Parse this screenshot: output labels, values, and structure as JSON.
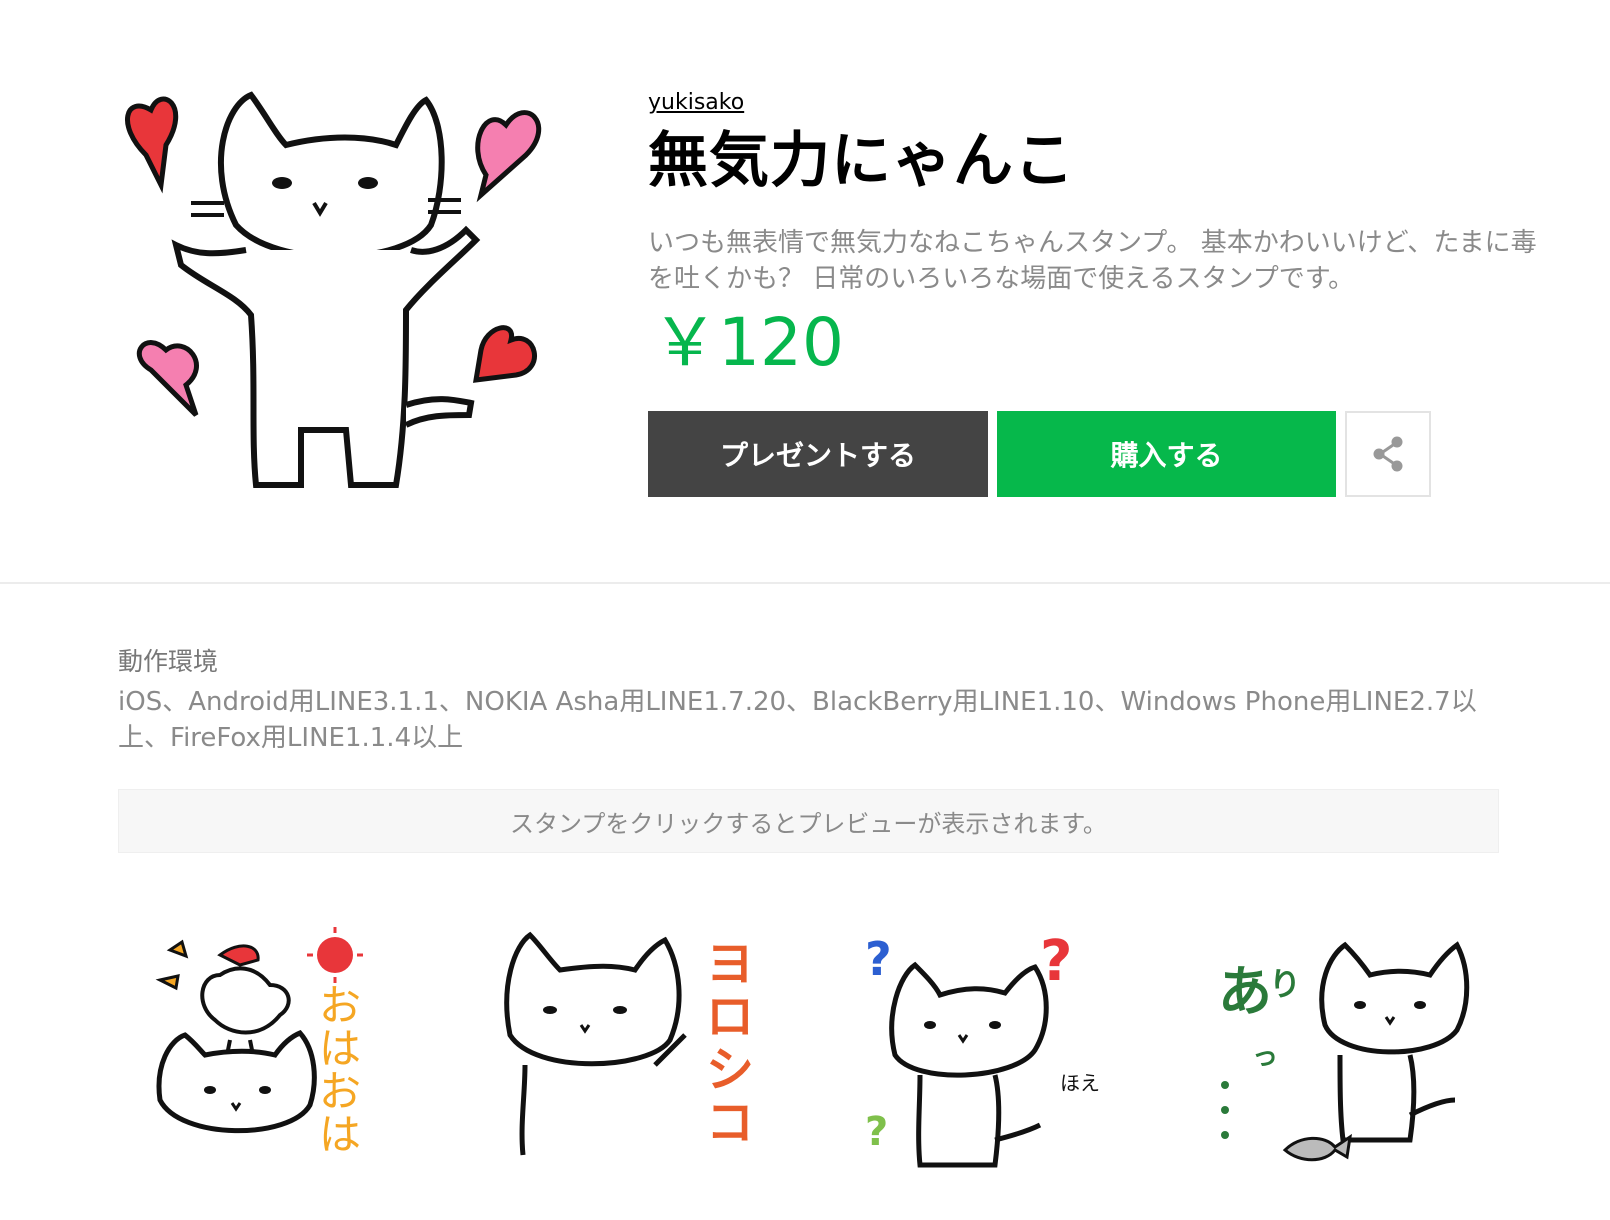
{
  "product": {
    "author": "yukisako",
    "title": "無気力にゃんこ",
    "description": "いつも無表情で無気力なねこちゃんスタンプ。 基本かわいいけど、たまに毒を吐くかも？ 日常のいろいろな場面で使えるスタンプです。",
    "price": "￥120",
    "gift_label": "プレゼントする",
    "buy_label": "購入する",
    "share_icon": "share-icon"
  },
  "environment": {
    "label": "動作環境",
    "text": "iOS、Android用LINE3.1.1、NOKIA Asha用LINE1.7.20、BlackBerry用LINE1.10、Windows Phone用LINE2.7以上、FireFox用LINE1.1.4以上"
  },
  "preview_hint": "スタンプをクリックするとプレビューが表示されます。",
  "stickers": [
    {
      "caption": "おはおは",
      "name": "sticker-ohaoha"
    },
    {
      "caption": "ヨロシコ",
      "name": "sticker-yoroshiko"
    },
    {
      "caption": "ほえ",
      "name": "sticker-hoe"
    },
    {
      "caption": "あり…",
      "name": "sticker-ari"
    }
  ],
  "colors": {
    "price": "#06b64d",
    "buy_button": "#06b84b",
    "gift_button": "#444444"
  }
}
